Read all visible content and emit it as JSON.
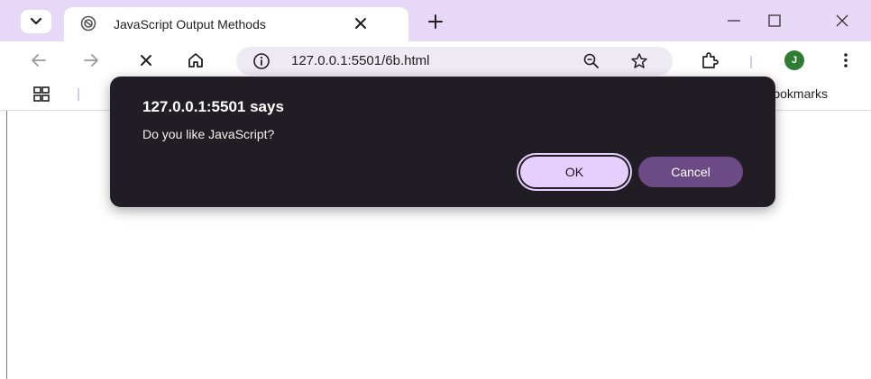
{
  "browser": {
    "tab": {
      "title": "JavaScript Output Methods"
    },
    "address_bar": {
      "url": "127.0.0.1:5501/6b.html"
    },
    "profile": {
      "initial": "J",
      "color": "#2e7d32"
    },
    "bookmarks_bar": {
      "all_bookmarks_label": "Bookmarks"
    }
  },
  "dialog": {
    "title": "127.0.0.1:5501 says",
    "message": "Do you like JavaScript?",
    "ok_label": "OK",
    "cancel_label": "Cancel"
  },
  "colors": {
    "tabstrip_bg": "#e8d8f8",
    "dialog_bg": "#211d24",
    "ok_button_bg": "#e7cffd",
    "cancel_button_bg": "#6c4a86"
  }
}
